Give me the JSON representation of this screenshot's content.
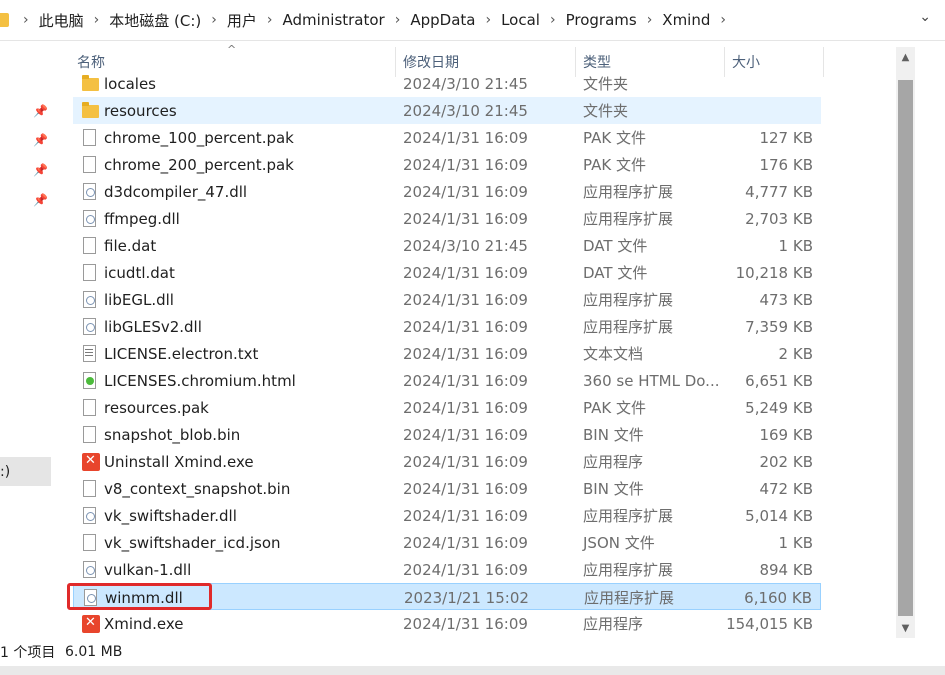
{
  "breadcrumb": [
    "此电脑",
    "本地磁盘 (C:)",
    "用户",
    "Administrator",
    "AppData",
    "Local",
    "Programs",
    "Xmind"
  ],
  "columns": {
    "name": "名称",
    "date": "修改日期",
    "type": "类型",
    "size": "大小"
  },
  "nav": {
    "drive_label": ":)"
  },
  "files": [
    {
      "name": "locales",
      "date": "2024/3/10 21:45",
      "type": "文件夹",
      "size": "",
      "icon": "folder-icon"
    },
    {
      "name": "resources",
      "date": "2024/3/10 21:45",
      "type": "文件夹",
      "size": "",
      "icon": "folder-icon"
    },
    {
      "name": "chrome_100_percent.pak",
      "date": "2024/1/31 16:09",
      "type": "PAK 文件",
      "size": "127 KB",
      "icon": "file-icon"
    },
    {
      "name": "chrome_200_percent.pak",
      "date": "2024/1/31 16:09",
      "type": "PAK 文件",
      "size": "176 KB",
      "icon": "file-icon"
    },
    {
      "name": "d3dcompiler_47.dll",
      "date": "2024/1/31 16:09",
      "type": "应用程序扩展",
      "size": "4,777 KB",
      "icon": "dll-icon"
    },
    {
      "name": "ffmpeg.dll",
      "date": "2024/1/31 16:09",
      "type": "应用程序扩展",
      "size": "2,703 KB",
      "icon": "dll-icon"
    },
    {
      "name": "file.dat",
      "date": "2024/3/10 21:45",
      "type": "DAT 文件",
      "size": "1 KB",
      "icon": "file-icon"
    },
    {
      "name": "icudtl.dat",
      "date": "2024/1/31 16:09",
      "type": "DAT 文件",
      "size": "10,218 KB",
      "icon": "file-icon"
    },
    {
      "name": "libEGL.dll",
      "date": "2024/1/31 16:09",
      "type": "应用程序扩展",
      "size": "473 KB",
      "icon": "dll-icon"
    },
    {
      "name": "libGLESv2.dll",
      "date": "2024/1/31 16:09",
      "type": "应用程序扩展",
      "size": "7,359 KB",
      "icon": "dll-icon"
    },
    {
      "name": "LICENSE.electron.txt",
      "date": "2024/1/31 16:09",
      "type": "文本文档",
      "size": "2 KB",
      "icon": "text-file-icon"
    },
    {
      "name": "LICENSES.chromium.html",
      "date": "2024/1/31 16:09",
      "type": "360 se HTML Do...",
      "size": "6,651 KB",
      "icon": "html-file-icon"
    },
    {
      "name": "resources.pak",
      "date": "2024/1/31 16:09",
      "type": "PAK 文件",
      "size": "5,249 KB",
      "icon": "file-icon"
    },
    {
      "name": "snapshot_blob.bin",
      "date": "2024/1/31 16:09",
      "type": "BIN 文件",
      "size": "169 KB",
      "icon": "file-icon"
    },
    {
      "name": "Uninstall Xmind.exe",
      "date": "2024/1/31 16:09",
      "type": "应用程序",
      "size": "202 KB",
      "icon": "xmind-app-icon"
    },
    {
      "name": "v8_context_snapshot.bin",
      "date": "2024/1/31 16:09",
      "type": "BIN 文件",
      "size": "472 KB",
      "icon": "file-icon"
    },
    {
      "name": "vk_swiftshader.dll",
      "date": "2024/1/31 16:09",
      "type": "应用程序扩展",
      "size": "5,014 KB",
      "icon": "dll-icon"
    },
    {
      "name": "vk_swiftshader_icd.json",
      "date": "2024/1/31 16:09",
      "type": "JSON 文件",
      "size": "1 KB",
      "icon": "file-icon"
    },
    {
      "name": "vulkan-1.dll",
      "date": "2024/1/31 16:09",
      "type": "应用程序扩展",
      "size": "894 KB",
      "icon": "dll-icon"
    },
    {
      "name": "winmm.dll",
      "date": "2023/1/21 15:02",
      "type": "应用程序扩展",
      "size": "6,160 KB",
      "icon": "dll-icon",
      "state": "selected"
    },
    {
      "name": "Xmind.exe",
      "date": "2024/1/31 16:09",
      "type": "应用程序",
      "size": "154,015 KB",
      "icon": "xmind-app-icon"
    }
  ],
  "status": {
    "count": "1 个项目",
    "size": "6.01 MB"
  },
  "colors": {
    "selection": "#cce8ff",
    "hover": "#e5f3ff",
    "highlight_box": "#e02a2a",
    "header_text": "#4c607a"
  }
}
